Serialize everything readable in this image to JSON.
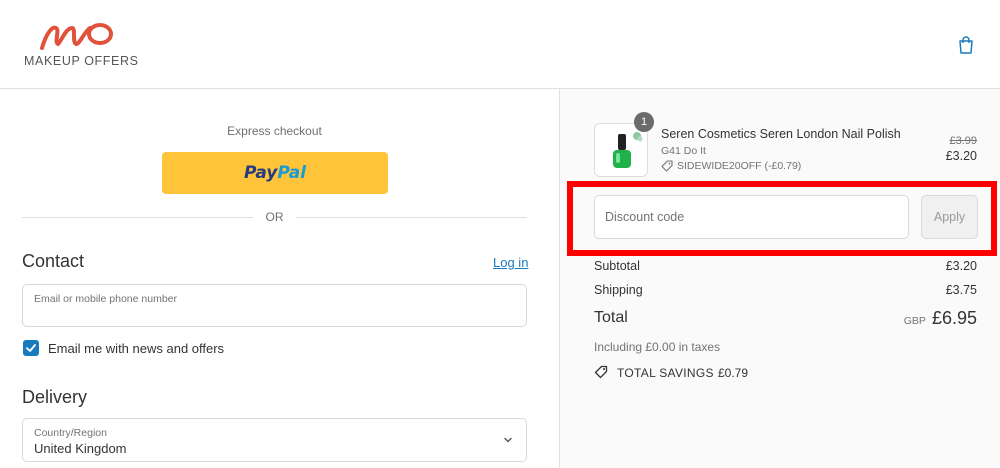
{
  "header": {
    "logo_text": "MAKEUP OFFERS"
  },
  "express": {
    "label": "Express checkout",
    "paypal_part1": "Pay",
    "paypal_part2": "Pal",
    "divider": "OR"
  },
  "contact": {
    "title": "Contact",
    "login_link": "Log in",
    "email_label": "Email or mobile phone number",
    "newsletter_label": "Email me with news and offers",
    "newsletter_checked": true
  },
  "delivery": {
    "title": "Delivery",
    "country_label": "Country/Region",
    "country_value": "United Kingdom"
  },
  "order": {
    "quantity": "1",
    "product_name": "Seren Cosmetics Seren London Nail Polish",
    "variant": "G41 Do It",
    "discount_applied": "SIDEWIDE20OFF (-£0.79)",
    "original_price": "£3.99",
    "price": "£3.20"
  },
  "discount": {
    "placeholder": "Discount code",
    "apply_label": "Apply"
  },
  "summary": {
    "subtotal_label": "Subtotal",
    "subtotal_value": "£3.20",
    "shipping_label": "Shipping",
    "shipping_value": "£3.75",
    "total_label": "Total",
    "currency": "GBP",
    "total_value": "£6.95",
    "taxes_note": "Including £0.00 in taxes",
    "savings_label": "TOTAL SAVINGS",
    "savings_value": "£0.79"
  },
  "colors": {
    "accent": "#197bbd",
    "paypal_yellow": "#ffc439",
    "highlight": "#ff0000",
    "logo_red": "#e0523a"
  },
  "icons": {
    "bag": "shopping-bag-icon",
    "tag": "tag-icon",
    "check": "check-icon",
    "chevron": "chevron-down-icon"
  }
}
